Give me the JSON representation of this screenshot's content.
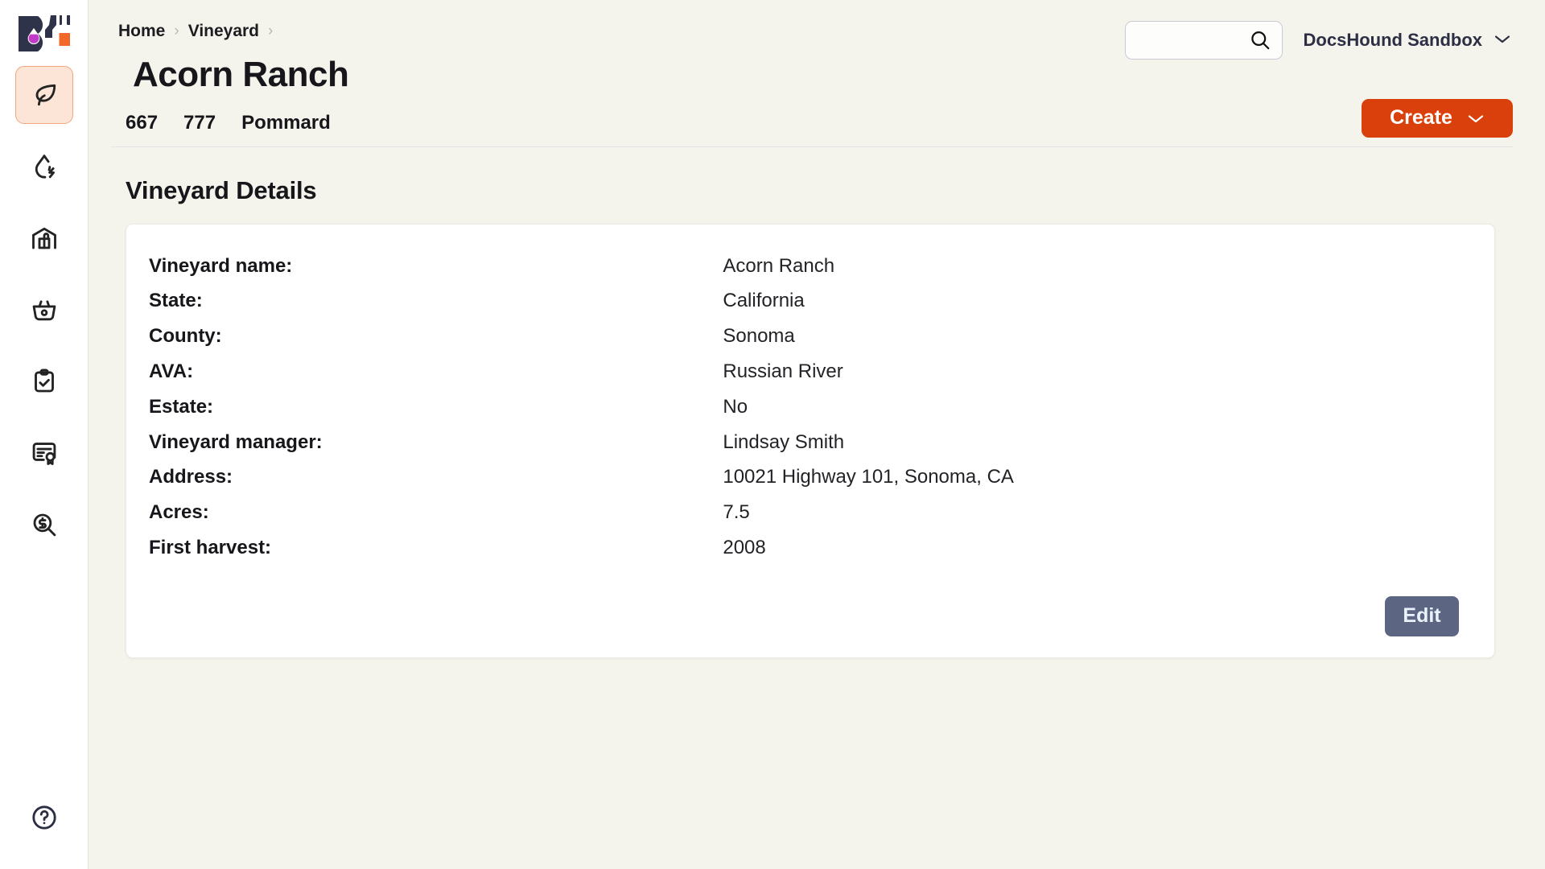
{
  "brand": {
    "logo_name": "bottle-drop-logo",
    "colors": {
      "navy": "#2F3349",
      "magenta": "#C23BC8",
      "orange": "#F2682A",
      "accent_create": "#D9400B",
      "edit_button": "#5C6683",
      "page_background": "#F5F4EC",
      "card_background": "#FFFFFF",
      "active_nav_background": "#FCE4D6",
      "active_nav_border": "#EFA77E"
    }
  },
  "sidebar": {
    "items": [
      {
        "name": "vineyard",
        "icon": "leaf-icon",
        "active": true
      },
      {
        "name": "fermentation",
        "icon": "droplet-bolt-icon",
        "active": false
      },
      {
        "name": "warehouse",
        "icon": "warehouse-box-icon",
        "active": false
      },
      {
        "name": "harvest-basket",
        "icon": "basket-icon",
        "active": false
      },
      {
        "name": "tasks",
        "icon": "clipboard-check-icon",
        "active": false
      },
      {
        "name": "certificates",
        "icon": "certificate-icon",
        "active": false
      },
      {
        "name": "cost-analysis",
        "icon": "dollar-search-icon",
        "active": false
      }
    ],
    "footer": {
      "name": "help",
      "icon": "help-circle-icon"
    }
  },
  "header": {
    "breadcrumb": [
      {
        "label": "Home"
      },
      {
        "label": "Vineyard"
      }
    ],
    "breadcrumb_separator": "›",
    "title": "Acorn Ranch",
    "search": {
      "value": "",
      "placeholder": "",
      "icon": "search-icon"
    },
    "org_switcher": {
      "label": "DocsHound Sandbox",
      "icon": "chevron-down-icon"
    }
  },
  "subbar": {
    "clones": [
      "667",
      "777",
      "Pommard"
    ],
    "create_button": {
      "label": "Create",
      "icon": "chevron-down-icon"
    }
  },
  "details": {
    "section_title": "Vineyard Details",
    "rows": [
      {
        "label": "Vineyard name:",
        "value": "Acorn Ranch"
      },
      {
        "label": "State:",
        "value": "California"
      },
      {
        "label": "County:",
        "value": "Sonoma"
      },
      {
        "label": "AVA:",
        "value": "Russian River"
      },
      {
        "label": "Estate:",
        "value": "No"
      },
      {
        "label": "Vineyard manager:",
        "value": "Lindsay Smith"
      },
      {
        "label": "Address:",
        "value": "10021 Highway 101, Sonoma, CA"
      },
      {
        "label": "Acres:",
        "value": "7.5"
      },
      {
        "label": "First harvest:",
        "value": "2008"
      }
    ],
    "edit_button": {
      "label": "Edit"
    }
  }
}
